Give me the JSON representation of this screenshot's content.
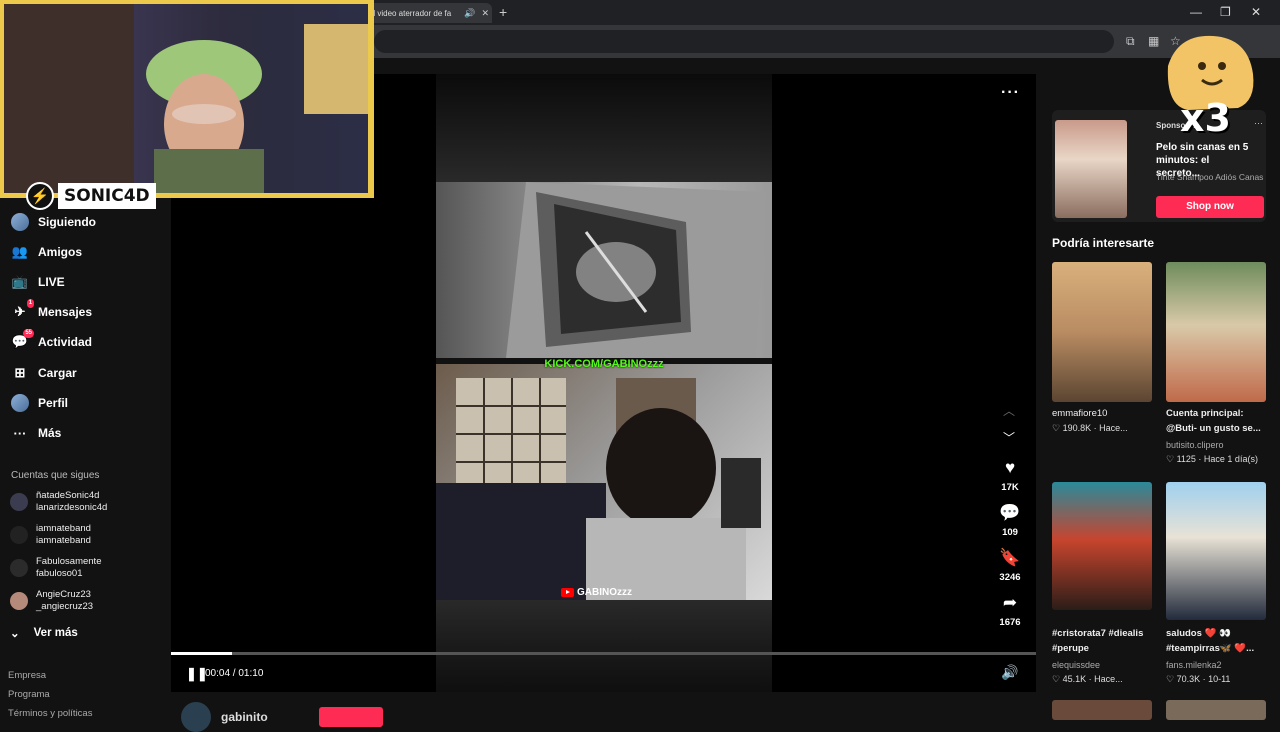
{
  "browser": {
    "tab_title": "El video aterrador de fa",
    "new_tab_symbol": "+",
    "close_symbol": "✕"
  },
  "overlay": {
    "streamer_name": "SONIC4D",
    "emoji_multiplier": "x3"
  },
  "sidebar": {
    "nav": [
      {
        "label": "Siguiendo",
        "icon": "following-icon"
      },
      {
        "label": "Amigos",
        "icon": "friends-icon"
      },
      {
        "label": "LIVE",
        "icon": "live-icon"
      },
      {
        "label": "Mensajes",
        "icon": "messages-icon",
        "badge": "1"
      },
      {
        "label": "Actividad",
        "icon": "activity-icon",
        "badge": "55"
      },
      {
        "label": "Cargar",
        "icon": "upload-icon"
      },
      {
        "label": "Perfil",
        "icon": "profile-icon"
      },
      {
        "label": "Más",
        "icon": "more-icon"
      }
    ],
    "following_title": "Cuentas que sigues",
    "following": [
      {
        "name": "ñatadeSonic4d",
        "handle": "lanarizdesonic4d"
      },
      {
        "name": "iamnateband",
        "handle": "iamnateband"
      },
      {
        "name": "Fabulosamente",
        "handle": "fabuloso01"
      },
      {
        "name": "AngieCruz23",
        "handle": "_angiecruz23"
      }
    ],
    "see_more": "Ver más",
    "footer": [
      "Empresa",
      "Programa",
      "Términos y políticas"
    ]
  },
  "player": {
    "kick_text": "KICK.COM/GABINOzzz",
    "yt_tag": "GABINOzzz",
    "time": "00:04 / 01:10",
    "progress": 0.07,
    "author": "gabinito",
    "actions": [
      {
        "icon": "heart-icon",
        "count": "17K"
      },
      {
        "icon": "comment-icon",
        "count": "109"
      },
      {
        "icon": "bookmark-icon",
        "count": "3246"
      },
      {
        "icon": "share-icon",
        "count": "1676"
      }
    ]
  },
  "right": {
    "sponsored_label": "Sponsored",
    "ad_title": "Pelo sin canas en 5 minutos: el secreto...",
    "ad_sub": "Tinte Shampoo Adiós Canas",
    "shop_label": "Shop now",
    "rec_title": "Podría interesarte",
    "cards": [
      {
        "title": "emmafiore10",
        "title_bold": false,
        "user": "",
        "stats": "♡ 190.8K · Hace..."
      },
      {
        "title": "Cuenta principal: @Buti- un gusto se...",
        "title_bold": true,
        "user": "butisito.clipero",
        "stats": "♡ 1125 · Hace 1 día(s)"
      },
      {
        "title": "#cristorata7 #diealis #perupe",
        "title_bold": true,
        "user": "elequissdee",
        "stats": "♡ 45.1K · Hace..."
      },
      {
        "title": "saludos ❤️ 👀 #teampirras🦋 ❤️...",
        "title_bold": true,
        "user": "fans.milenka2",
        "stats": "♡ 70.3K · 10-11"
      }
    ]
  }
}
